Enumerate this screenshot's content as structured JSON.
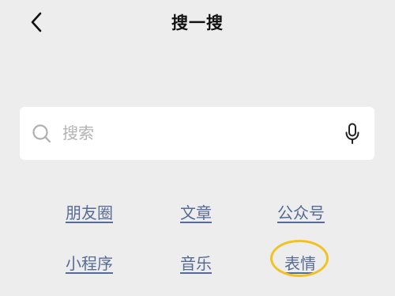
{
  "header": {
    "title": "搜一搜"
  },
  "search": {
    "placeholder": "搜索",
    "value": ""
  },
  "categories": [
    {
      "label": "朋友圈"
    },
    {
      "label": "文章"
    },
    {
      "label": "公众号"
    },
    {
      "label": "小程序"
    },
    {
      "label": "音乐"
    },
    {
      "label": "表情"
    }
  ],
  "icons": {
    "back": "chevron-left-icon",
    "search": "search-icon",
    "mic": "microphone-icon"
  },
  "colors": {
    "background": "#ededed",
    "link": "#576b95",
    "highlight": "#f0c224"
  }
}
